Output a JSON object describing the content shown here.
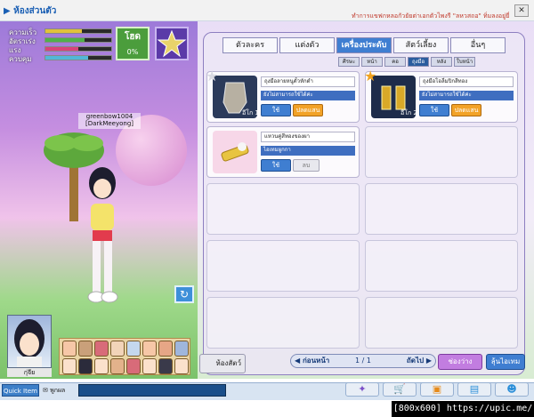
{
  "window": {
    "title": "▶ ห้องส่วนตัว",
    "notice": "ทำการแขฟกหลอกัวยัยต่าเอกตัวไพงรี \"ลหวสถอ\" ทิ่มลงอยู่ยี่",
    "close_label": "✕"
  },
  "stats": [
    {
      "label": "ความเร็ว",
      "level": 0.55,
      "color": "#e0c23a"
    },
    {
      "label": "อัตราเร่ง",
      "level": 0.6,
      "color": "#4fb04a"
    },
    {
      "label": "แรง",
      "level": 0.5,
      "color": "#d9437a"
    },
    {
      "label": "ควบคุม",
      "level": 0.65,
      "color": "#52b7d8"
    }
  ],
  "hot": {
    "label": "โฮด",
    "value": "0%"
  },
  "character": {
    "name_line1": "greenbow1004",
    "name_line2": "[DarkMeeyong]"
  },
  "portrait_name": "กุ่จีย",
  "shop": {
    "tabs": [
      {
        "label": "ตัวละคร",
        "active": false
      },
      {
        "label": "แต่งตัว",
        "active": false
      },
      {
        "label": "เครื่องประดับ",
        "active": true
      },
      {
        "label": "สัตว์เลี้ยง",
        "active": false
      },
      {
        "label": "อื่นๆ",
        "active": false
      }
    ],
    "subtabs": [
      {
        "label": "ศีรษะ",
        "active": false
      },
      {
        "label": "หน้า",
        "active": false
      },
      {
        "label": "คอ",
        "active": false
      },
      {
        "label": "ถุงมือ",
        "active": true
      },
      {
        "label": "หลัง",
        "active": false
      },
      {
        "label": "ใบหน้า",
        "active": false
      }
    ],
    "items": [
      {
        "name": "ถุงมือลายหนูตั้วหักดำ",
        "status": "ยังไม่สามารถใช้ได้ค่ะ",
        "use": "ใช้",
        "action": "ปลดแสน",
        "level": "อีโก 1",
        "star": "silver"
      },
      {
        "name": "ถุงมือโอลี่มปิกสีทอง",
        "status": "ยังไม่สามารถใช้ได้ค่ะ",
        "use": "ใช้",
        "action": "ปลดแสน",
        "level": "อีโก 2",
        "star": "gold"
      },
      {
        "name": "แหวนคู่สีทองของผา",
        "status": "ไอเทมผูกกา",
        "use": "ใช้",
        "action": "ลบ",
        "level": "",
        "star": "none"
      }
    ],
    "bottom": {
      "my_items": "ห้องสัตว์",
      "prev": "◀ ก่อนหน้า",
      "page": "1 / 1",
      "next": "ถัดไป ▶",
      "reset": "ช่องว่าง",
      "refill": "ลุ้นไอเทม"
    }
  },
  "quickbar": {
    "quick_label": "Quick Item",
    "mail_label": "✉ พูกผล"
  },
  "credit": "[800x600] https://upic.me/"
}
